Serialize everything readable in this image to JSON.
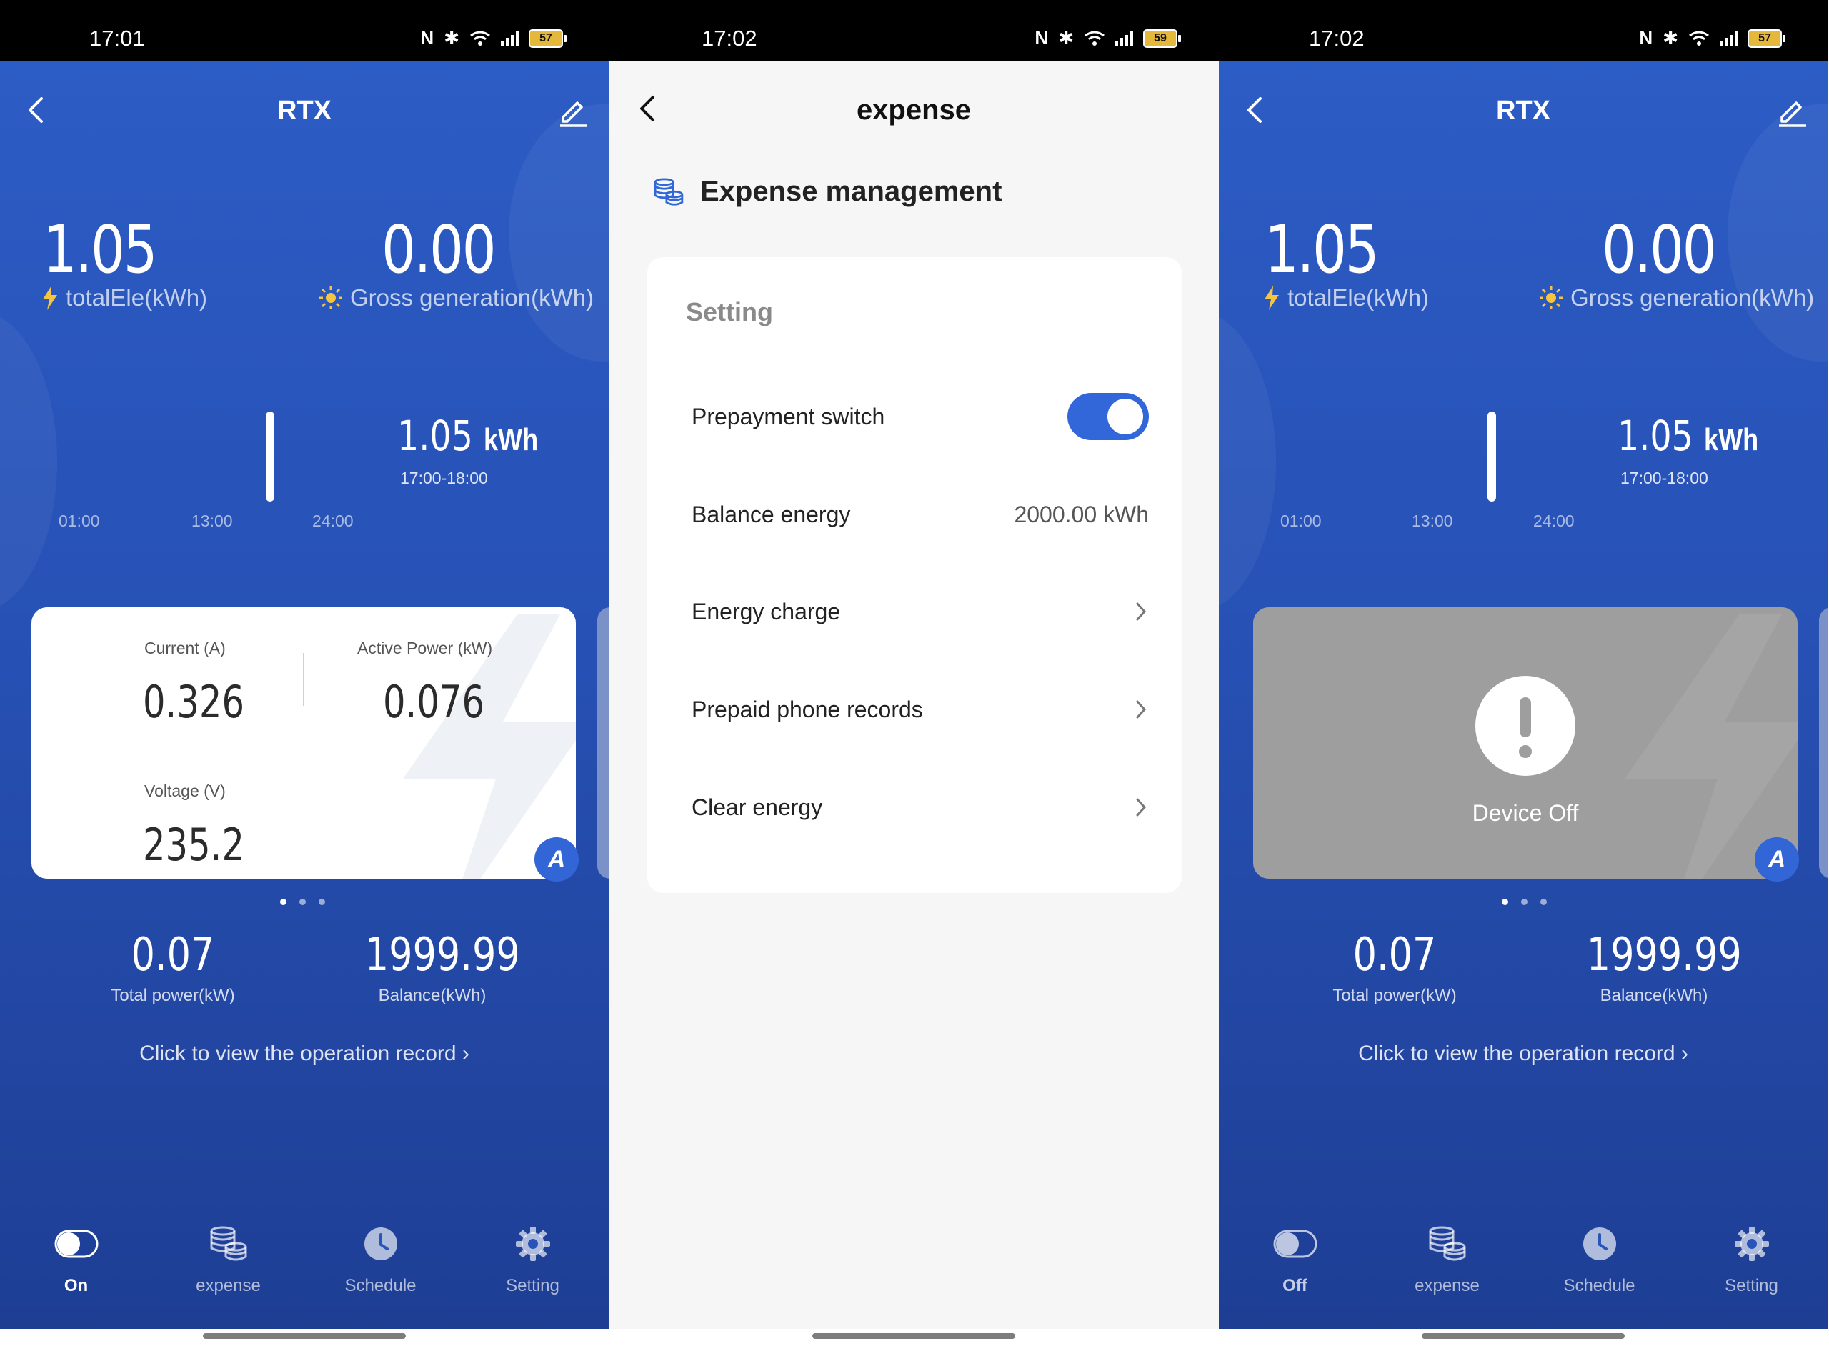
{
  "screens": {
    "left": {
      "status_time": "17:01",
      "battery": "57",
      "nav_title": "RTX",
      "total_ele_value": "1.05",
      "total_ele_label": "totalEle(kWh)",
      "gross_value": "0.00",
      "gross_label": "Gross generation(kWh)",
      "chart_value": "1.05",
      "chart_unit": "kWh",
      "chart_range": "17:00-18:00",
      "ticks": [
        "01:00",
        "13:00",
        "24:00"
      ],
      "card": {
        "current_label": "Current (A)",
        "current_value": "0.326",
        "power_label": "Active Power (kW)",
        "power_value": "0.076",
        "voltage_label": "Voltage (V)",
        "voltage_value": "235.2",
        "badge": "A"
      },
      "total_power_value": "0.07",
      "total_power_label": "Total power(kW)",
      "balance_value": "1999.99",
      "balance_label": "Balance(kWh)",
      "operation_record": "Click to view the operation record",
      "tabs": [
        "On",
        "expense",
        "Schedule",
        "Setting"
      ]
    },
    "middle": {
      "status_time": "17:02",
      "battery": "59",
      "nav_title": "expense",
      "section_title": "Expense management",
      "card_heading": "Setting",
      "rows": {
        "prepayment_label": "Prepayment switch",
        "prepayment_on": true,
        "balance_label": "Balance energy",
        "balance_value": "2000.00 kWh",
        "charge_label": "Energy charge",
        "records_label": "Prepaid phone records",
        "clear_label": "Clear energy"
      }
    },
    "right": {
      "status_time": "17:02",
      "battery": "57",
      "nav_title": "RTX",
      "total_ele_value": "1.05",
      "total_ele_label": "totalEle(kWh)",
      "gross_value": "0.00",
      "gross_label": "Gross generation(kWh)",
      "chart_value": "1.05",
      "chart_unit": "kWh",
      "chart_range": "17:00-18:00",
      "ticks": [
        "01:00",
        "13:00",
        "24:00"
      ],
      "device_off": "Device Off",
      "badge": "A",
      "total_power_value": "0.07",
      "total_power_label": "Total power(kW)",
      "balance_value": "1999.99",
      "balance_label": "Balance(kWh)",
      "operation_record": "Click to view the operation record",
      "tabs": [
        "Off",
        "expense",
        "Schedule",
        "Setting"
      ]
    }
  },
  "colors": {
    "primary_blue": "#2c5cc5",
    "toggle_blue": "#3167d8",
    "battery_yellow": "#e5b83b",
    "bolt_yellow": "#f5c542"
  },
  "icons": [
    "back-arrow-icon",
    "edit-pen-icon",
    "bolt-icon",
    "sun-icon",
    "toggle-icon",
    "coins-icon",
    "clock-icon",
    "gear-icon",
    "chevron-right-icon",
    "exclamation-icon",
    "nfc-icon",
    "bluetooth-icon",
    "wifi-icon",
    "signal-icon",
    "battery-icon"
  ]
}
